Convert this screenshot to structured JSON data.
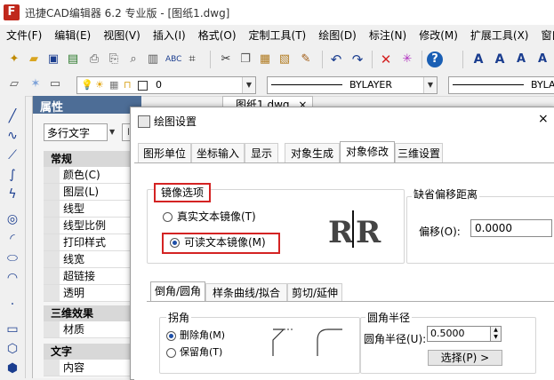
{
  "app": {
    "title": "迅捷CAD编辑器 6.2 专业版 - [图纸1.dwg]",
    "logo_letter": "F"
  },
  "menu": [
    "文件(F)",
    "编辑(E)",
    "视图(V)",
    "插入(I)",
    "格式(O)",
    "定制工具(T)",
    "绘图(D)",
    "标注(N)",
    "修改(M)",
    "扩展工具(X)",
    "窗口"
  ],
  "toolbar2": {
    "layer_value": "0",
    "linetype_value": "BYLAYER",
    "lineweight_value": "BYLA"
  },
  "properties": {
    "header": "属性",
    "selector": "多行文字",
    "categories": [
      {
        "name": "常规",
        "rows": [
          "颜色(C)",
          "图层(L)",
          "线型",
          "线型比例",
          "打印样式",
          "线宽",
          "超链接",
          "透明"
        ]
      },
      {
        "name": "三维效果",
        "rows": [
          "材质"
        ]
      },
      {
        "name": "文字",
        "rows": [
          "内容"
        ]
      }
    ]
  },
  "drawing_tab": {
    "label": "图纸1.dwg",
    "close": "×"
  },
  "dialog": {
    "title": "绘图设置",
    "close": "×",
    "tabs": [
      "图形单位",
      "坐标输入",
      "显示",
      "对象生成",
      "对象修改",
      "三维设置"
    ],
    "active_tab": "对象修改",
    "mirror": {
      "label": "镜像选项",
      "option_true_text": "真实文本镜像(T)",
      "option_readable_text": "可读文本镜像(M)",
      "selected": "option_readable_text",
      "preview": "R|R"
    },
    "offset": {
      "label": "缺省偏移距离",
      "caption": "偏移(O):",
      "value": "0.0000"
    },
    "subtabs": [
      "倒角/圆角",
      "样条曲线/拟合",
      "剪切/延伸"
    ],
    "active_subtab": "倒角/圆角",
    "chamfer": {
      "label": "拐角",
      "option_delete": "删除角(M)",
      "option_keep": "保留角(T)",
      "selected": "option_delete"
    },
    "fillet": {
      "label": "圆角半径",
      "caption": "圆角半径(U):",
      "value": "0.5000",
      "select_button": "选择(P) >"
    }
  },
  "colors": {
    "highlight": "#d42323",
    "panel_header": "#4d6d96",
    "toolbar_blue": "#1a3d8f"
  }
}
